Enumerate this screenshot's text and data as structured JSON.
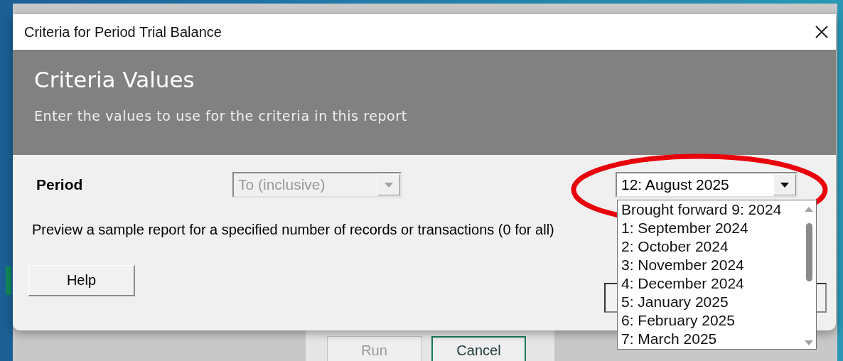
{
  "background_window": {
    "buttons": [
      {
        "label": "Run",
        "disabled": true
      },
      {
        "label": "Cancel",
        "disabled": false
      }
    ]
  },
  "dialog": {
    "title": "Criteria for Period Trial Balance"
  },
  "header": {
    "title": "Criteria Values",
    "subtitle": "Enter the values to use for the criteria in this report"
  },
  "criteria": [
    {
      "label": "Period",
      "operator": {
        "value": "To (inclusive)",
        "disabled": true
      },
      "value": {
        "value": "12: August 2025",
        "expanded": true,
        "options": [
          "Brought forward 9: 2024",
          "1: September 2024",
          "2: October 2024",
          "3: November 2024",
          "4: December 2024",
          "5: January 2025",
          "6: February 2025",
          "7: March 2025"
        ]
      }
    }
  ],
  "preview_text": "Preview a sample report for a specified number of records or transactions (0 for all)",
  "buttons": [
    {
      "label": "Help"
    }
  ]
}
